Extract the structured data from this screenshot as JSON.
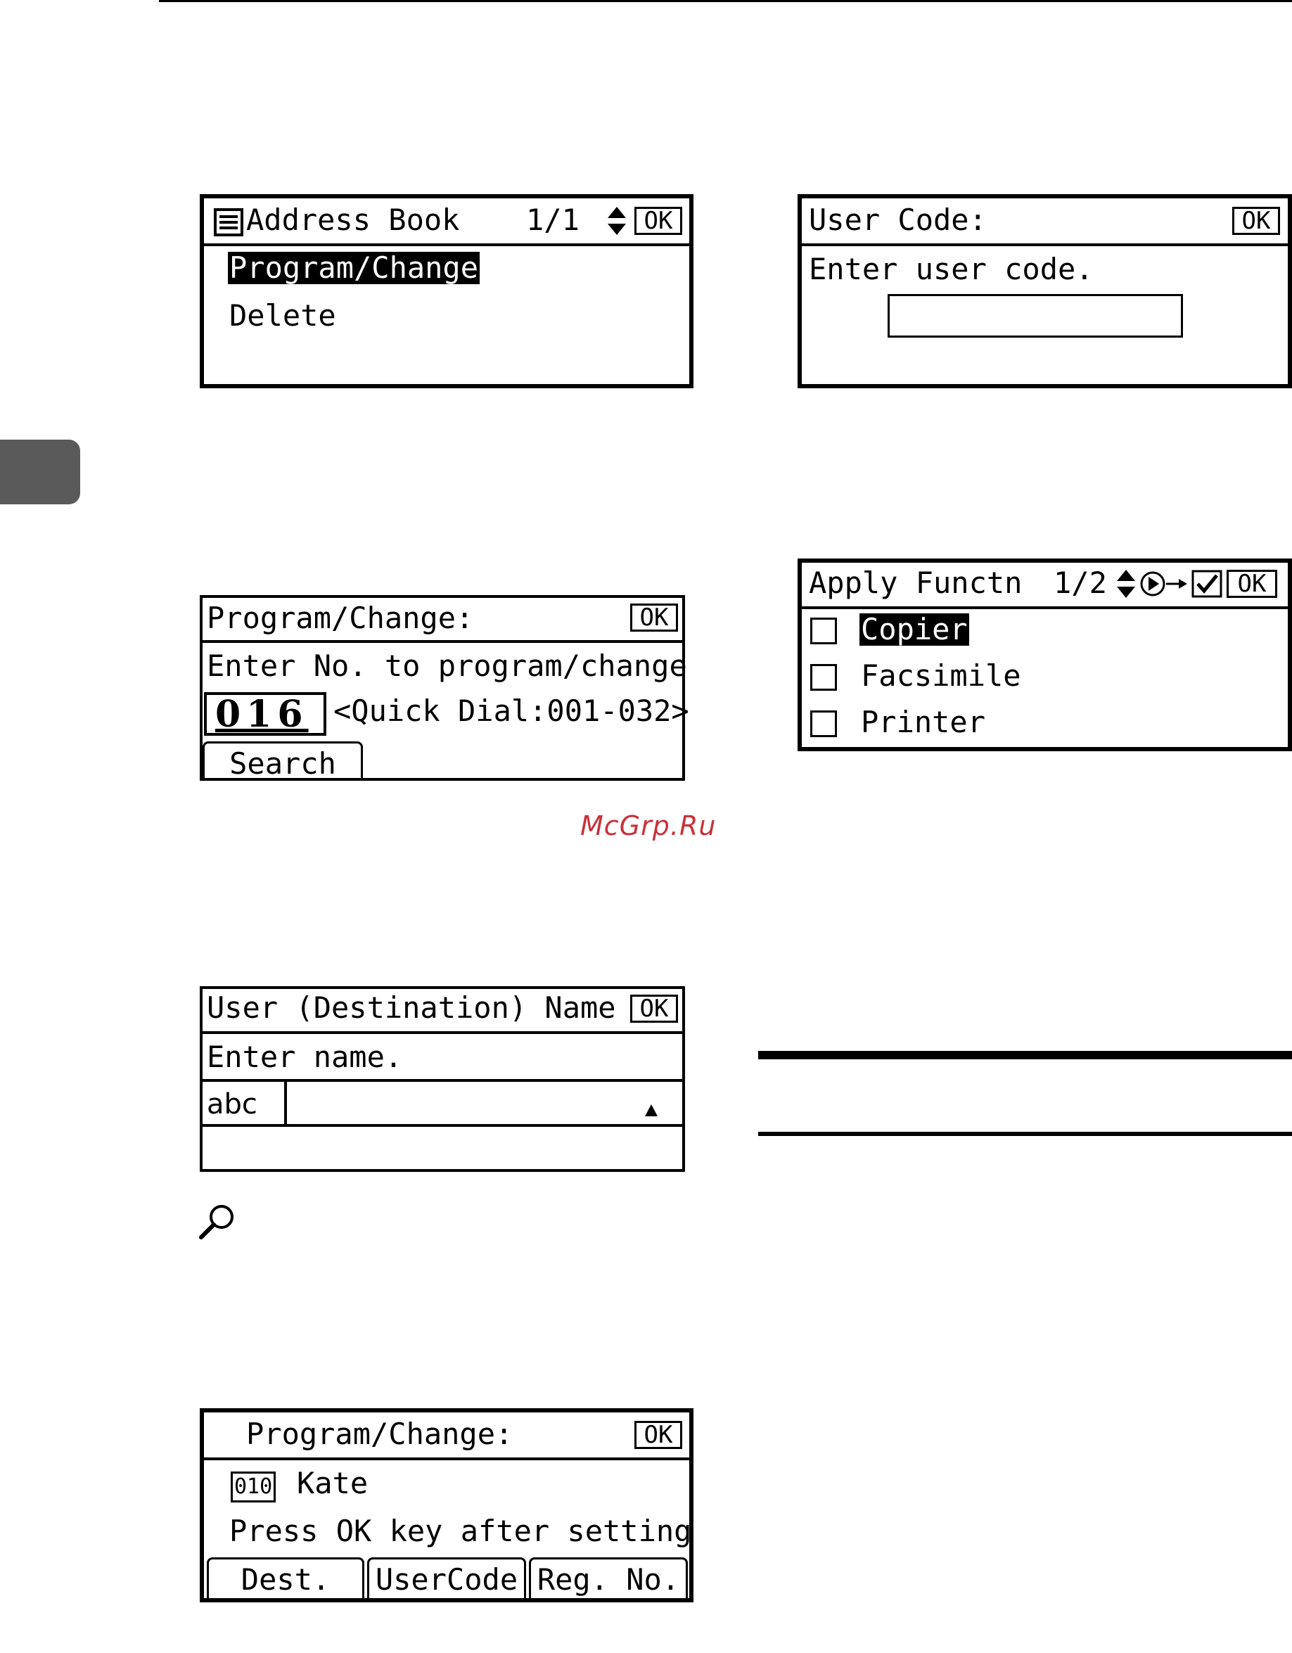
{
  "address_book": {
    "title": "Address Book",
    "page": "1/1",
    "ok": "OK",
    "items": [
      "Program/Change",
      "Delete"
    ]
  },
  "user_code": {
    "title": "User Code:",
    "ok": "OK",
    "prompt": "Enter user code.",
    "value": ""
  },
  "program_change": {
    "title": "Program/Change:",
    "ok": "OK",
    "prompt": "Enter No. to program/change",
    "number": "016",
    "range": "<Quick Dial:001-032>",
    "search": "Search"
  },
  "apply_functn": {
    "title": "Apply Functn",
    "page": "1/2",
    "ok": "OK",
    "options": [
      "Copier",
      "Facsimile",
      "Printer"
    ]
  },
  "watermark": "McGrp.Ru",
  "user_name": {
    "title": "User (Destination) Name",
    "ok": "OK",
    "prompt": "Enter name.",
    "mode": "abc",
    "value": ""
  },
  "program_change_2": {
    "title": "Program/Change:",
    "ok": "OK",
    "reg_no": "010",
    "name": "Kate",
    "message": "Press OK key after setting",
    "soft_keys": [
      "Dest.",
      "UserCode",
      "Reg. No."
    ]
  },
  "icons": {
    "address_book": "address-book-icon",
    "scroll": "up-down-arrow-icon",
    "next": "next-arrow-icon",
    "check": "checkmark-icon",
    "cursor": "cursor-triangle-icon",
    "reference": "magnifier-icon"
  }
}
